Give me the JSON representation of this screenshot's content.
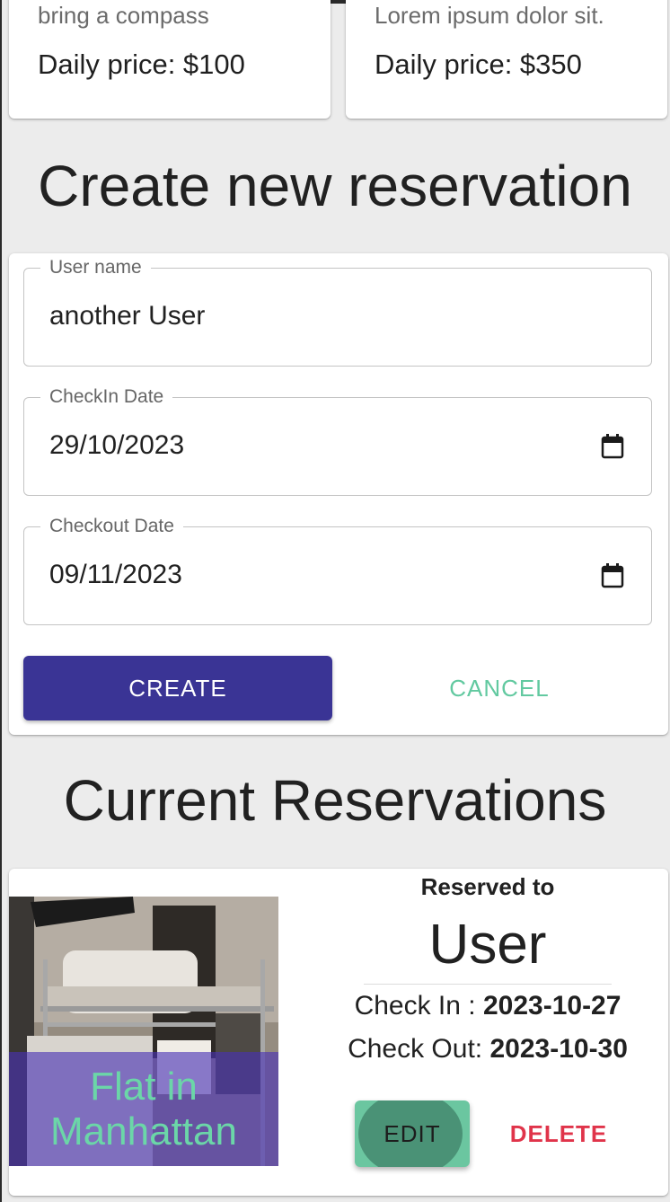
{
  "properties": [
    {
      "description": "bring a compass",
      "price": "Daily price: $100"
    },
    {
      "description": "Lorem ipsum dolor sit.",
      "price": "Daily price: $350"
    }
  ],
  "create_section": {
    "title": "Create new reservation",
    "user_name_label": "User name",
    "user_name_value": "another User",
    "checkin_label": "CheckIn Date",
    "checkin_value": "29/10/2023",
    "checkout_label": "Checkout Date",
    "checkout_value": "09/11/2023",
    "create_label": "CREATE",
    "cancel_label": "CANCEL"
  },
  "reservations_section": {
    "title": "Current Reservations",
    "items": [
      {
        "property_name": "Flat in Manhattan",
        "reserved_to_label": "Reserved to",
        "user": "User",
        "check_in_label": "Check In : ",
        "check_in_value": "2023-10-27",
        "check_out_label": "Check Out: ",
        "check_out_value": "2023-10-30",
        "edit_label": "EDIT",
        "delete_label": "DELETE"
      }
    ]
  },
  "icons": {
    "calendar": "calendar-icon"
  },
  "colors": {
    "primary": "#3a3495",
    "accent": "#62c9a0",
    "danger": "#e0344a",
    "overlay": "#4830b4"
  }
}
